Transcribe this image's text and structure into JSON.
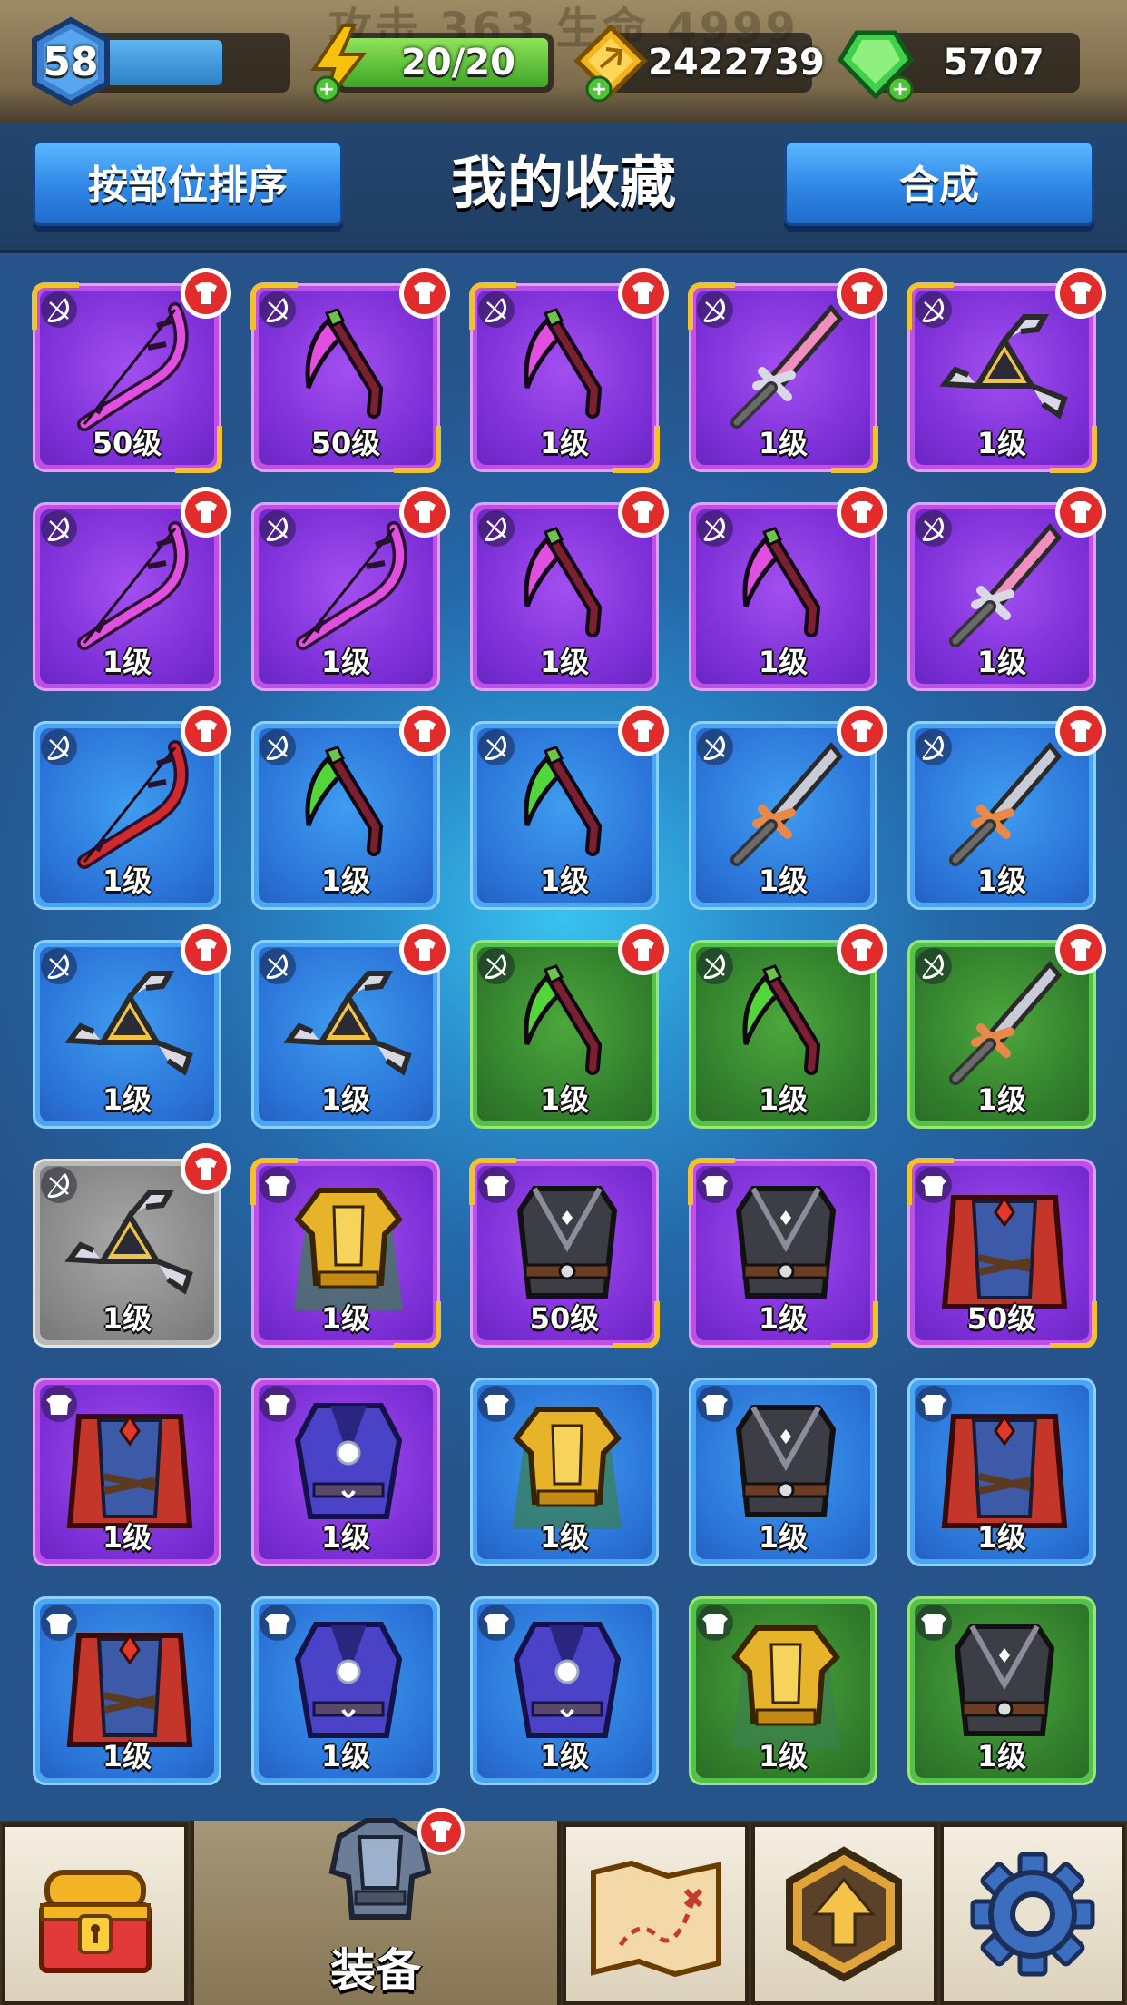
{
  "status_bar": {
    "ghost_text": "攻击 363 生命 4999",
    "level": "58",
    "level_progress": 0.72,
    "energy": "20/20",
    "gold": "2422739",
    "gems": "5707"
  },
  "header": {
    "sort_button": "按部位排序",
    "title": "我的收藏",
    "craft_button": "合成"
  },
  "colors": {
    "purple": "#8a3ae0",
    "blue": "#2f7fe0",
    "green": "#3b8f33",
    "gray": "#8d8d8d",
    "gold_frame": "#f2c12e",
    "new_badge": "#e52d2d"
  },
  "items": [
    {
      "icon": "bow-icon",
      "cat": "weapon",
      "rarity": "purple",
      "level": "50级",
      "gold": true,
      "new": true
    },
    {
      "icon": "scythe-icon",
      "cat": "weapon",
      "rarity": "purple",
      "level": "50级",
      "gold": true,
      "new": true
    },
    {
      "icon": "scythe-icon",
      "cat": "weapon",
      "rarity": "purple",
      "level": "1级",
      "gold": true,
      "new": true
    },
    {
      "icon": "sword-icon",
      "cat": "weapon",
      "rarity": "purple",
      "level": "1级",
      "gold": true,
      "new": true
    },
    {
      "icon": "shuriken-icon",
      "cat": "weapon",
      "rarity": "purple",
      "level": "1级",
      "gold": true,
      "new": true
    },
    {
      "icon": "bow-icon",
      "cat": "weapon",
      "rarity": "purple",
      "level": "1级",
      "gold": false,
      "new": true
    },
    {
      "icon": "bow-icon",
      "cat": "weapon",
      "rarity": "purple",
      "level": "1级",
      "gold": false,
      "new": true
    },
    {
      "icon": "scythe-icon",
      "cat": "weapon",
      "rarity": "purple",
      "level": "1级",
      "gold": false,
      "new": true
    },
    {
      "icon": "scythe-icon",
      "cat": "weapon",
      "rarity": "purple",
      "level": "1级",
      "gold": false,
      "new": true
    },
    {
      "icon": "sword-icon",
      "cat": "weapon",
      "rarity": "purple",
      "level": "1级",
      "gold": false,
      "new": true
    },
    {
      "icon": "bow-icon",
      "cat": "weapon",
      "rarity": "blue",
      "level": "1级",
      "gold": false,
      "new": true
    },
    {
      "icon": "scythe-icon",
      "cat": "weapon",
      "rarity": "blue",
      "level": "1级",
      "gold": false,
      "new": true
    },
    {
      "icon": "scythe-icon",
      "cat": "weapon",
      "rarity": "blue",
      "level": "1级",
      "gold": false,
      "new": true
    },
    {
      "icon": "sword-icon",
      "cat": "weapon",
      "rarity": "blue",
      "level": "1级",
      "gold": false,
      "new": true
    },
    {
      "icon": "sword-icon",
      "cat": "weapon",
      "rarity": "blue",
      "level": "1级",
      "gold": false,
      "new": true
    },
    {
      "icon": "shuriken-icon",
      "cat": "weapon",
      "rarity": "blue",
      "level": "1级",
      "gold": false,
      "new": true
    },
    {
      "icon": "shuriken-icon",
      "cat": "weapon",
      "rarity": "blue",
      "level": "1级",
      "gold": false,
      "new": true
    },
    {
      "icon": "scythe-icon",
      "cat": "weapon",
      "rarity": "green",
      "level": "1级",
      "gold": false,
      "new": true
    },
    {
      "icon": "scythe-icon",
      "cat": "weapon",
      "rarity": "green",
      "level": "1级",
      "gold": false,
      "new": true
    },
    {
      "icon": "sword-icon",
      "cat": "weapon",
      "rarity": "green",
      "level": "1级",
      "gold": false,
      "new": true
    },
    {
      "icon": "shuriken-icon",
      "cat": "weapon",
      "rarity": "gray",
      "level": "1级",
      "gold": false,
      "new": true
    },
    {
      "icon": "gold-armor-icon",
      "cat": "armor",
      "rarity": "purple",
      "level": "1级",
      "gold": true,
      "new": false
    },
    {
      "icon": "dark-vest-icon",
      "cat": "armor",
      "rarity": "purple",
      "level": "50级",
      "gold": true,
      "new": false
    },
    {
      "icon": "dark-vest-icon",
      "cat": "armor",
      "rarity": "purple",
      "level": "1级",
      "gold": true,
      "new": false
    },
    {
      "icon": "cape-armor-icon",
      "cat": "armor",
      "rarity": "purple",
      "level": "50级",
      "gold": true,
      "new": false
    },
    {
      "icon": "cape-armor-icon",
      "cat": "armor",
      "rarity": "purple",
      "level": "1级",
      "gold": false,
      "new": false
    },
    {
      "icon": "mage-robe-icon",
      "cat": "armor",
      "rarity": "purple",
      "level": "1级",
      "gold": false,
      "new": false
    },
    {
      "icon": "gold-armor-icon",
      "cat": "armor",
      "rarity": "blue",
      "level": "1级",
      "gold": false,
      "new": false
    },
    {
      "icon": "dark-vest-icon",
      "cat": "armor",
      "rarity": "blue",
      "level": "1级",
      "gold": false,
      "new": false
    },
    {
      "icon": "cape-armor-icon",
      "cat": "armor",
      "rarity": "blue",
      "level": "1级",
      "gold": false,
      "new": false
    },
    {
      "icon": "cape-armor-icon",
      "cat": "armor",
      "rarity": "blue",
      "level": "1级",
      "gold": false,
      "new": false
    },
    {
      "icon": "mage-robe-icon",
      "cat": "armor",
      "rarity": "blue",
      "level": "1级",
      "gold": false,
      "new": false
    },
    {
      "icon": "mage-robe-icon",
      "cat": "armor",
      "rarity": "blue",
      "level": "1级",
      "gold": false,
      "new": false
    },
    {
      "icon": "gold-armor-icon",
      "cat": "armor",
      "rarity": "green",
      "level": "1级",
      "gold": false,
      "new": false
    },
    {
      "icon": "dark-vest-icon",
      "cat": "armor",
      "rarity": "green",
      "level": "1级",
      "gold": false,
      "new": false
    }
  ],
  "nav": {
    "tabs": [
      {
        "icon": "treasure-chest-icon",
        "label": ""
      },
      {
        "icon": "armor-equip-icon",
        "label": "装备",
        "active": true
      },
      {
        "icon": "treasure-map-icon",
        "label": ""
      },
      {
        "icon": "upgrade-arrow-icon",
        "label": ""
      },
      {
        "icon": "settings-gear-icon",
        "label": ""
      }
    ]
  }
}
